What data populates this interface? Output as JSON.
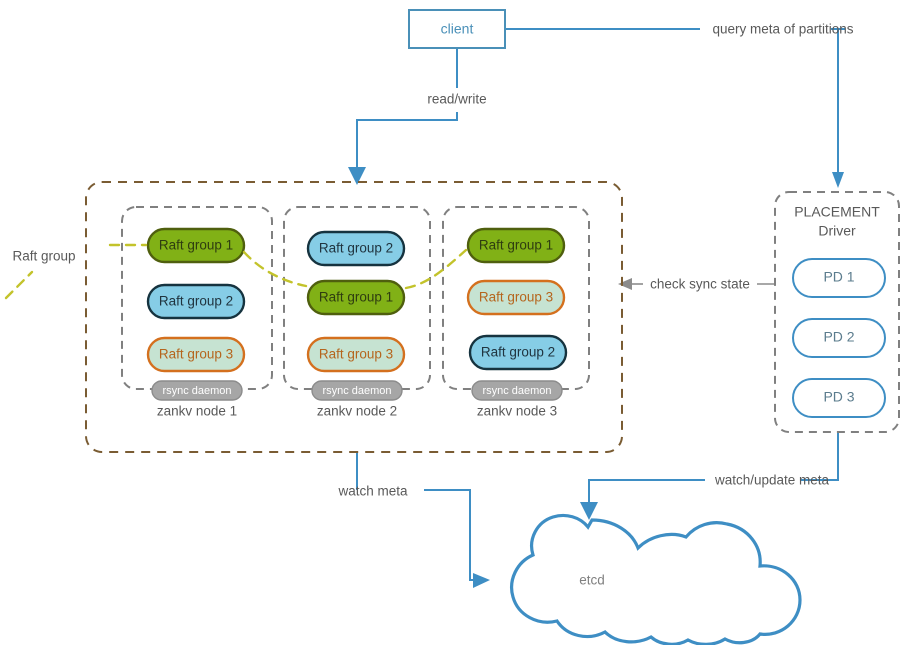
{
  "diagram": {
    "title_nodes": {
      "client": "client",
      "etcd": "etcd"
    },
    "edge_labels": {
      "query_meta": "query meta of partitions",
      "read_write": "read/write",
      "check_sync_state": "check sync state",
      "raft_group": "Raft group",
      "watch_meta": "watch meta",
      "watch_update_meta": "watch/update meta"
    },
    "placement_driver": {
      "title_line1": "PLACEMENT",
      "title_line2": "Driver",
      "items": [
        {
          "label": "PD 1"
        },
        {
          "label": "PD 2"
        },
        {
          "label": "PD 3"
        }
      ]
    },
    "nodes": [
      {
        "caption": "zankv node 1",
        "daemon": "rsync daemon",
        "groups": [
          {
            "label": "Raft group 1",
            "style": "green"
          },
          {
            "label": "Raft group 2",
            "style": "blue"
          },
          {
            "label": "Raft group 3",
            "style": "orange"
          }
        ]
      },
      {
        "caption": "zankv node 2",
        "daemon": "rsync daemon",
        "groups": [
          {
            "label": "Raft group 2",
            "style": "blue"
          },
          {
            "label": "Raft group 1",
            "style": "green"
          },
          {
            "label": "Raft group 3",
            "style": "orange"
          }
        ]
      },
      {
        "caption": "zankv node 3",
        "daemon": "rsync daemon",
        "groups": [
          {
            "label": "Raft group 1",
            "style": "green"
          },
          {
            "label": "Raft group 3",
            "style": "orange"
          },
          {
            "label": "Raft group 2",
            "style": "blue"
          }
        ]
      }
    ],
    "colors": {
      "blue_accent": "#3e8ec4",
      "green_fill": "#81b116",
      "green_stroke": "#4f5f0e",
      "blue_fill": "#86cde6",
      "blue_stroke": "#16333f",
      "orange_fill": "#c6e3d2",
      "orange_stroke": "#d4701e",
      "gray_fill": "#a6a6a6",
      "brown_dash": "#7a5c33",
      "olive_dash": "#c3c32b",
      "node_dash": "#808080"
    }
  }
}
